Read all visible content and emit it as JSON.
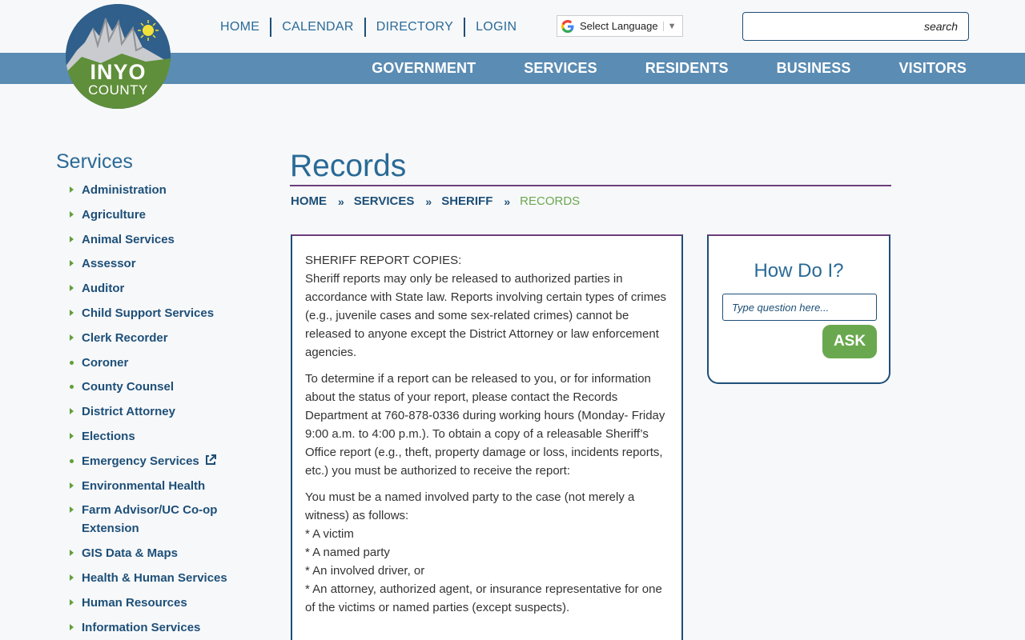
{
  "logo": {
    "line1": "INYO",
    "line2": "COUNTY"
  },
  "utility_nav": [
    "HOME",
    "CALENDAR",
    "DIRECTORY",
    "LOGIN"
  ],
  "translate": {
    "label": "Select Language"
  },
  "search": {
    "button": "search",
    "value": ""
  },
  "main_nav": [
    "GOVERNMENT",
    "SERVICES",
    "RESIDENTS",
    "BUSINESS",
    "VISITORS"
  ],
  "sidebar": {
    "title": "Services",
    "items": [
      {
        "label": "Administration",
        "marker": "triangle"
      },
      {
        "label": "Agriculture",
        "marker": "triangle"
      },
      {
        "label": "Animal Services",
        "marker": "triangle"
      },
      {
        "label": "Assessor",
        "marker": "triangle"
      },
      {
        "label": "Auditor",
        "marker": "triangle"
      },
      {
        "label": "Child Support Services",
        "marker": "triangle"
      },
      {
        "label": "Clerk Recorder",
        "marker": "triangle"
      },
      {
        "label": "Coroner",
        "marker": "dot"
      },
      {
        "label": "County Counsel",
        "marker": "dot"
      },
      {
        "label": "District Attorney",
        "marker": "triangle"
      },
      {
        "label": "Elections",
        "marker": "triangle"
      },
      {
        "label": "Emergency Services",
        "marker": "dot",
        "icon": "external-link-icon"
      },
      {
        "label": "Environmental Health",
        "marker": "triangle"
      },
      {
        "label": "Farm Advisor/UC Co-op Extension",
        "marker": "triangle"
      },
      {
        "label": "GIS Data & Maps",
        "marker": "triangle"
      },
      {
        "label": "Health & Human Services",
        "marker": "triangle"
      },
      {
        "label": "Human Resources",
        "marker": "triangle"
      },
      {
        "label": "Information Services",
        "marker": "triangle"
      }
    ]
  },
  "page": {
    "title": "Records",
    "breadcrumb": [
      "HOME",
      "SERVICES",
      "SHERIFF"
    ],
    "breadcrumb_current": "RECORDS"
  },
  "article": {
    "p1_heading": "SHERIFF REPORT COPIES:",
    "p1_body": "Sheriff reports may only be released to authorized parties in accordance with State law. Reports involving certain types of crimes (e.g., juvenile cases and some sex-related crimes) cannot be released to anyone except the District Attorney or law enforcement agencies.",
    "p2": "To determine if a report can be released to you, or for information about the status of your report, please contact the Records Department at 760-878-0336 during working hours (Monday- Friday 9:00 a.m. to 4:00 p.m.). To obtain a copy of a releasable Sheriff’s Office report (e.g., theft, property damage or loss, incidents reports, etc.) you must be authorized to receive the report:",
    "p3_intro": "You must be a named involved party to the case (not merely a witness) as follows:",
    "p3_items": [
      "* A victim",
      "* A named party",
      "* An involved driver, or",
      "* An attorney, authorized agent, or insurance representative for one of the victims or named parties (except suspects)."
    ]
  },
  "how_do_i": {
    "title": "How Do I?",
    "placeholder": "Type question here...",
    "button": "ASK"
  },
  "colors": {
    "brand_blue": "#1d4f78",
    "nav_band": "#5b8cb3",
    "accent_green": "#6aa84f",
    "accent_purple": "#6b3f7a"
  }
}
